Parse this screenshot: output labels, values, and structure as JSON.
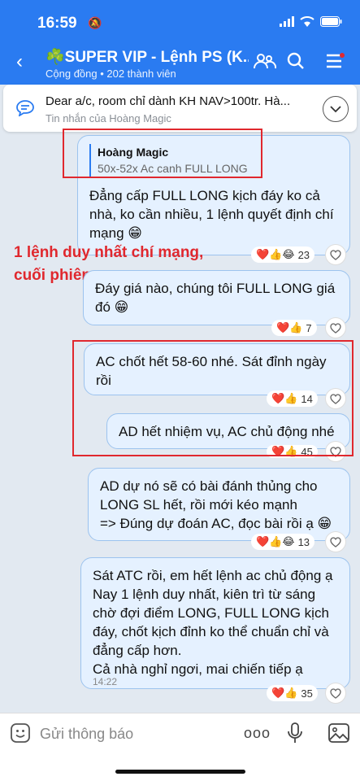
{
  "status": {
    "time": "16:59"
  },
  "header": {
    "title": "☘️SUPER VIP - Lệnh PS (K...",
    "subtitle": "Cộng đồng • 202 thành viên"
  },
  "pinned": {
    "text": "Dear a/c, room chỉ dành KH NAV>100tr. Hà...",
    "sub": "Tin nhắn của Hoàng Magic"
  },
  "messages": [
    {
      "quote_author": "Hoàng Magic",
      "quote_text": "50x-52x Ac canh FULL LONG",
      "text": "Đẳng cấp FULL LONG kịch đáy ko cả\nnhà, ko cần nhiều, 1 lệnh quyết định chí\nmạng 😁",
      "reactions": "❤️👍😂",
      "count": "23"
    },
    {
      "text": "Đáy giá nào, chúng tôi FULL LONG giá\nđó 😁",
      "reactions": "❤️👍",
      "count": "7"
    },
    {
      "text": "AC chốt hết 58-60 nhé. Sát đỉnh ngày\nrồi",
      "reactions": "❤️👍",
      "count": "14"
    },
    {
      "text": "AD hết nhiệm vụ, AC chủ động nhé",
      "reactions": "❤️👍",
      "count": "45"
    },
    {
      "text": "AD dự nó sẽ có bài đánh thủng cho\nLONG SL hết, rồi mới kéo mạnh\n=> Đúng dự đoán AC, đọc bài rồi ạ 😁",
      "reactions": "❤️👍😂",
      "count": "13"
    },
    {
      "text": "Sát ATC rồi, em hết lệnh ac chủ động ạ\nNay 1 lệnh duy nhất, kiên trì từ sáng\nchờ đợi điểm LONG, FULL LONG kịch\nđáy, chốt kịch đỉnh ko thể chuẩn chỉ và\nđẳng cấp hơn.\nCả nhà nghỉ ngơi, mai chiến tiếp ạ",
      "time": "14:22",
      "reactions": "❤️👍",
      "count": "35"
    }
  ],
  "overlay_text": "1 lệnh duy nhất chí mạng,\ncuối phiên",
  "composer": {
    "placeholder": "Gửi thông báo"
  },
  "colors": {
    "accent": "#2a7bf1",
    "annotation": "#e0282e",
    "bubble": "#e5f1ff"
  }
}
